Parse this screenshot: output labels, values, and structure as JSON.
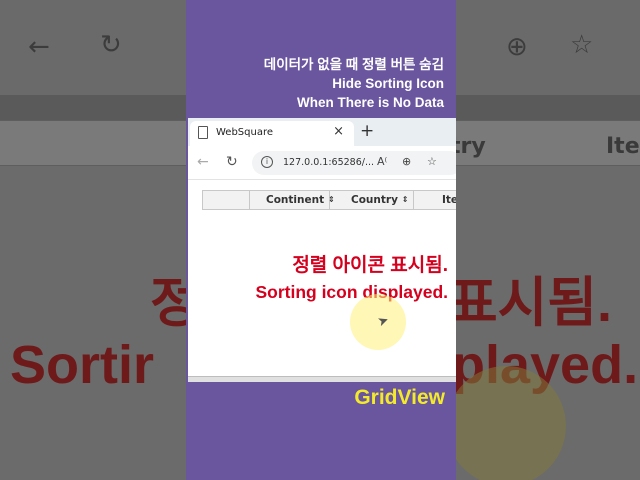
{
  "caption": {
    "korean": "데이터가 없을 때 정렬 버튼 숨김",
    "english_line1": "Hide Sorting Icon",
    "english_line2": "When There is No Data"
  },
  "browser": {
    "tab_title": "WebSquare",
    "tab_close": "×",
    "new_tab": "+",
    "url": "127.0.0.1:65286/...",
    "icons": [
      "back-arrow-icon",
      "reload-icon",
      "info-icon",
      "read-aloud-icon",
      "zoom-icon",
      "favorite-star-icon"
    ]
  },
  "grid": {
    "columns": [
      {
        "label": "",
        "sortable": false
      },
      {
        "label": "Continent",
        "sortable": true
      },
      {
        "label": "Country",
        "sortable": true
      },
      {
        "label": "Ite",
        "sortable": false
      }
    ],
    "sort_glyph": "⇕"
  },
  "message": {
    "korean": "정렬 아이콘 표시됨.",
    "english": "Sorting icon displayed."
  },
  "footer_label": "GridView",
  "background": {
    "ghost_korean_left": "정",
    "ghost_english_left": "Sortir",
    "ghost_korean_right": "표시됨.",
    "ghost_english_right": "played.",
    "ghost_column_right": "try",
    "ghost_column_far": "Ite"
  },
  "colors": {
    "panel": "#6a559f",
    "message": "#d4001e",
    "footer_label": "#f2ea2b"
  }
}
